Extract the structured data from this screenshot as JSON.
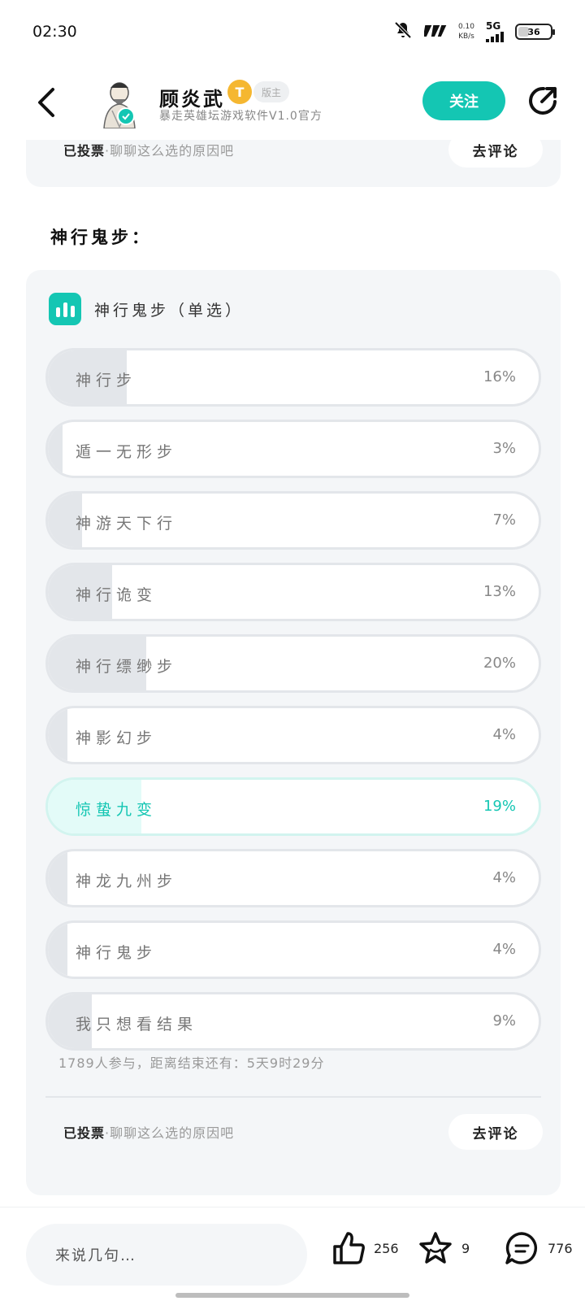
{
  "status_bar": {
    "time": "02:30",
    "net_speed_value": "0.10",
    "net_speed_unit": "KB/s",
    "network_type": "5G",
    "battery_level": "36"
  },
  "header": {
    "user_name": "顾炎武",
    "level_badge": "T",
    "level_tag": "版主",
    "user_desc": "暴走英雄坛游戏软件V1.0官方",
    "follow_label": "关注"
  },
  "top_card": {
    "voted_prefix": "已投票",
    "voted_suffix": "·聊聊这么选的原因吧",
    "comment_label": "去评论"
  },
  "section_title": "神行鬼步：",
  "poll": {
    "title": "神行鬼步（单选）",
    "options": [
      {
        "label": "神行步",
        "pct": "16%",
        "value": 16
      },
      {
        "label": "遁一无形步",
        "pct": "3%",
        "value": 3
      },
      {
        "label": "神游天下行",
        "pct": "7%",
        "value": 7
      },
      {
        "label": "神行诡变",
        "pct": "13%",
        "value": 13
      },
      {
        "label": "神行缥缈步",
        "pct": "20%",
        "value": 20
      },
      {
        "label": "神影幻步",
        "pct": "4%",
        "value": 4
      },
      {
        "label": "惊蛰九变",
        "pct": "19%",
        "value": 19,
        "selected": true
      },
      {
        "label": "神龙九州步",
        "pct": "4%",
        "value": 4
      },
      {
        "label": "神行鬼步",
        "pct": "4%",
        "value": 4
      },
      {
        "label": "我只想看结果",
        "pct": "9%",
        "value": 9
      }
    ],
    "stats": "1789人参与，距离结束还有：5天9时29分",
    "voted_prefix": "已投票",
    "voted_suffix": "·聊聊这么选的原因吧",
    "comment_label": "去评论"
  },
  "bottom_bar": {
    "input_placeholder": "来说几句…",
    "like_count": "256",
    "star_count": "9",
    "comment_count": "776"
  },
  "colors": {
    "accent": "#14c6b3",
    "card_bg": "#f4f6f8",
    "fill_gray": "#e3e6ea",
    "fill_selected": "#e3fbf8"
  }
}
